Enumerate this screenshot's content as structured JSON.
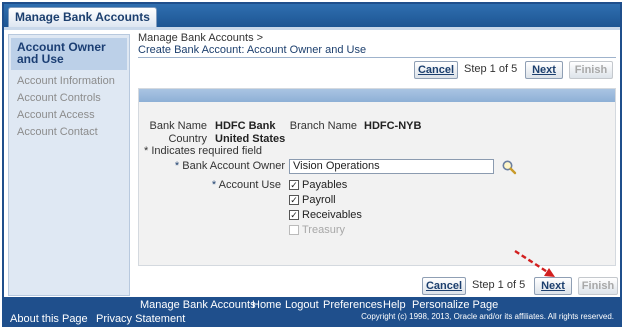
{
  "tab": {
    "label": "Manage Bank Accounts"
  },
  "leftnav": {
    "active": "Account Owner and Use",
    "items": [
      "Account Information",
      "Account Controls",
      "Account Access",
      "Account Contact"
    ]
  },
  "header": {
    "breadcrumb": "Manage Bank Accounts  >",
    "title": "Create Bank Account: Account Owner and Use"
  },
  "buttons": {
    "cancel": "Cancel",
    "next": "Next",
    "finish": "Finish"
  },
  "step_text": "Step 1 of 5",
  "details": {
    "bank_name_label": "Bank Name",
    "bank_name": "HDFC Bank",
    "branch_name_label": "Branch Name",
    "branch_name": "HDFC-NYB",
    "country_label": "Country",
    "country": "United States",
    "required_note": "* Indicates required field",
    "owner_label": "Bank Account Owner",
    "owner_value": "Vision Operations",
    "use_label": "Account Use",
    "req_star": "*"
  },
  "uses": [
    {
      "label": "Payables",
      "checked": true,
      "disabled": false
    },
    {
      "label": "Payroll",
      "checked": true,
      "disabled": false
    },
    {
      "label": "Receivables",
      "checked": true,
      "disabled": false
    },
    {
      "label": "Treasury",
      "checked": false,
      "disabled": true
    }
  ],
  "footer": {
    "links": [
      "Manage Bank Accounts",
      "Home",
      "Logout",
      "Preferences",
      "Help",
      "Personalize Page"
    ],
    "about": "About this Page",
    "privacy": "Privacy Statement",
    "copyright": "Copyright (c) 1998, 2013, Oracle and/or its affiliates. All rights reserved."
  },
  "colors": {
    "brand": "#1f4f8c",
    "arrow": "#d21f1f"
  },
  "icons": {
    "search": "magnifier-icon"
  }
}
